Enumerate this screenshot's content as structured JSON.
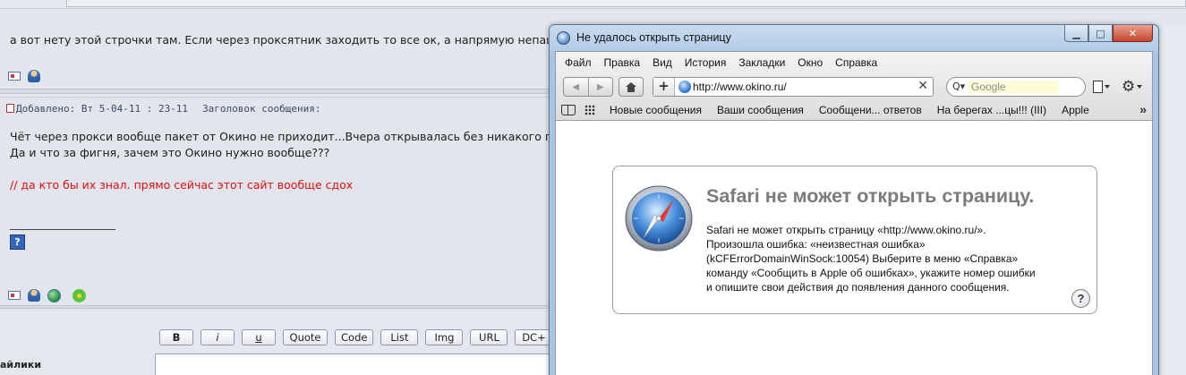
{
  "forum": {
    "post1": {
      "message": "а вот нету этой строчки там. Если через проксятник заходить то все ок, а напрямую непашет."
    },
    "post2": {
      "added_label": "Добавлено: Вт 5-04-11 : 23-11",
      "subject_label": "Заголовок сообщения:",
      "line1": "Чёт через прокси вообще пакет от Окино не приходит...Вчера открывалась без никакого прокси",
      "line2": "Да и что за фигня, зачем это Окино нужно вообще???",
      "quote_red": "// да кто бы их знал. прямо сейчас этот сайт вообще сдох",
      "help_glyph": "?"
    },
    "editor": {
      "buttons": [
        "B",
        "i",
        "u",
        "Quote",
        "Code",
        "List",
        "Img",
        "URL",
        "DC+"
      ],
      "smileys_label": "айлики"
    }
  },
  "safari": {
    "window_title": "Не удалось открыть страницу",
    "window_buttons": {
      "minimize": "▁",
      "maximize": "□",
      "close": "✕"
    },
    "menu": [
      "Файл",
      "Правка",
      "Вид",
      "История",
      "Закладки",
      "Окно",
      "Справка"
    ],
    "nav": {
      "back": "◀",
      "forward": "▶"
    },
    "address": {
      "plus": "+",
      "url": "http://www.okino.ru/",
      "clear": "✕"
    },
    "search": {
      "icon": "Q▾",
      "placeholder": "Google"
    },
    "bookmarks": [
      "Новые сообщения",
      "Ваши сообщения",
      "Сообщени... ответов",
      "На берегах ...цы!!! (III)",
      "Apple"
    ],
    "bookmarks_more": "»",
    "error": {
      "title": "Safari не может открыть страницу.",
      "lines": [
        "Safari не может открыть страницу «http://www.okino.ru/».",
        "Произошла ошибка: «неизвестная ошибка»",
        "(kCFErrorDomainWinSock:10054) Выберите в меню «Справка»",
        "команду «Сообщить в Apple об ошибках», укажите номер ошибки",
        "и опишите свои действия до появления данного сообщения."
      ],
      "help_glyph": "?"
    },
    "icons": {
      "title": "safari-compass-icon",
      "gear": "gear-icon",
      "page": "page-menu-icon",
      "bookmarks": "book-icon",
      "top_sites": "grid-icon"
    }
  },
  "colors": {
    "forum_bg": "#e4e7ed",
    "red_text": "#e01010",
    "window_frame": "#a9c4e2",
    "close_button": "#c8462f",
    "error_title": "#7b7b7b"
  }
}
